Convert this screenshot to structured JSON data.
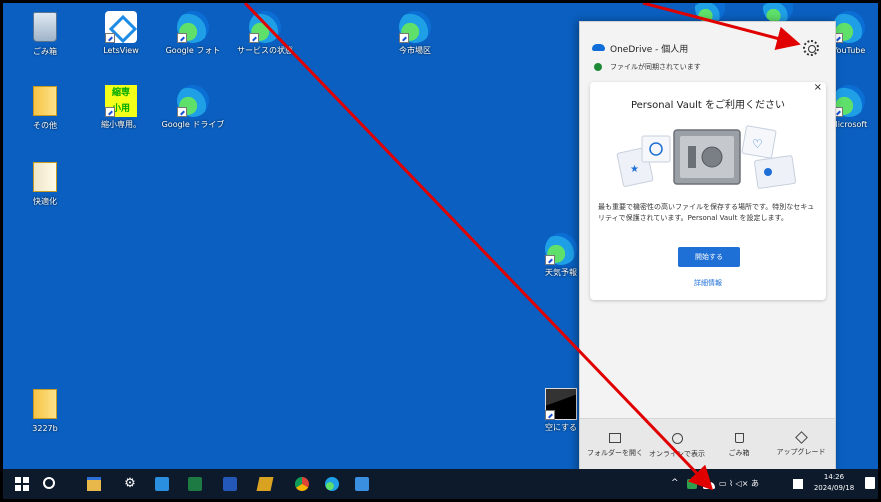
{
  "desktop": {
    "icons": [
      {
        "name": "recycle-bin",
        "label": "ごみ箱"
      },
      {
        "name": "letsview",
        "label": "LetsView"
      },
      {
        "name": "google-photos",
        "label": "Google フォト"
      },
      {
        "name": "service-status",
        "label": "サービスの状態"
      },
      {
        "name": "city-office",
        "label": "今市場区"
      },
      {
        "name": "other",
        "label": "その他"
      },
      {
        "name": "shukushou",
        "label": "縮小専用。"
      },
      {
        "name": "google-drive",
        "label": "Google ドライブ"
      },
      {
        "name": "kaiteki",
        "label": "快適化"
      },
      {
        "name": "weather",
        "label": "天気予報"
      },
      {
        "name": "folder-3227b",
        "label": "3227b"
      },
      {
        "name": "sky",
        "label": "空にする"
      },
      {
        "name": "youtube",
        "label": "YouTube"
      },
      {
        "name": "microsoft",
        "label": "Microsoft"
      }
    ],
    "shukushou_text": "縮専\n小用"
  },
  "onedrive": {
    "title": "OneDrive - 個人用",
    "status": "ファイルが同期されています",
    "card": {
      "close": "×",
      "title": "Personal Vault をご利用ください",
      "body": "最も重要で機密性の高いファイルを保存する場所です。特別なセキュリティで保護されています。Personal Vault を設定します。",
      "start_button": "開始する",
      "more_link": "詳細情報"
    },
    "footer": [
      {
        "label": "フォルダーを開く"
      },
      {
        "label": "オンラインで表示"
      },
      {
        "label": "ごみ箱"
      },
      {
        "label": "アップグレード"
      }
    ]
  },
  "taskbar": {
    "tray_chevron": "^",
    "tray_symbols": "▭ ⌇ ◁× あ",
    "time": "14:26",
    "date": "2024/09/18"
  },
  "colors": {
    "desktop": "#0a5fc0",
    "accent": "#1e6fd6",
    "annotation_arrow": "#e00000"
  }
}
